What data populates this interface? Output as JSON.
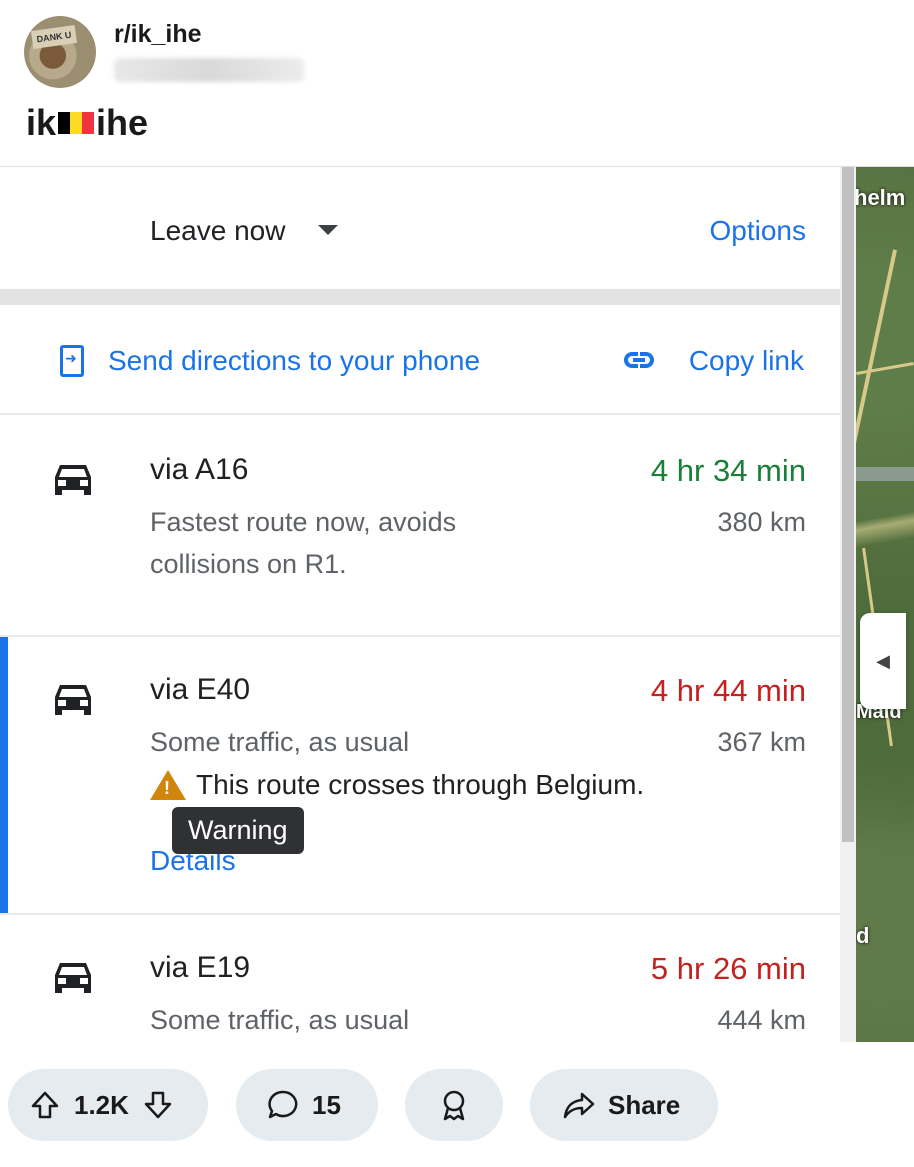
{
  "post": {
    "subreddit": "r/ik_ihe",
    "avatar_sign": "DANK U",
    "title_prefix": "ik",
    "title_suffix": "ihe"
  },
  "directions": {
    "leave_now": "Leave now",
    "options": "Options",
    "send_directions": "Send directions to your phone",
    "copy_link": "Copy link",
    "routes": [
      {
        "name": "via A16",
        "time": "4 hr 34 min",
        "time_color": "#188038",
        "desc": "Fastest route now, avoids collisions on R1.",
        "distance": "380 km"
      },
      {
        "name": "via E40",
        "time": "4 hr 44 min",
        "time_color": "#c5221f",
        "desc": "Some traffic, as usual",
        "distance": "367 km",
        "warning": "This route crosses through Belgium.",
        "details": "Details",
        "tooltip": "Warning"
      },
      {
        "name": "via E19",
        "time": "5 hr 26 min",
        "time_color": "#c5221f",
        "desc": "Some traffic, as usual",
        "distance": "444 km"
      }
    ]
  },
  "map": {
    "label_top": "helm",
    "label_mid": "Mald",
    "label_low": "d"
  },
  "actions": {
    "votes": "1.2K",
    "comments": "15",
    "share": "Share"
  },
  "icons": [
    "upvote-icon",
    "downvote-icon",
    "comment-icon",
    "award-icon",
    "share-icon",
    "car-icon",
    "warning-icon",
    "phone-send-icon",
    "link-icon",
    "dropdown-caret-icon"
  ]
}
